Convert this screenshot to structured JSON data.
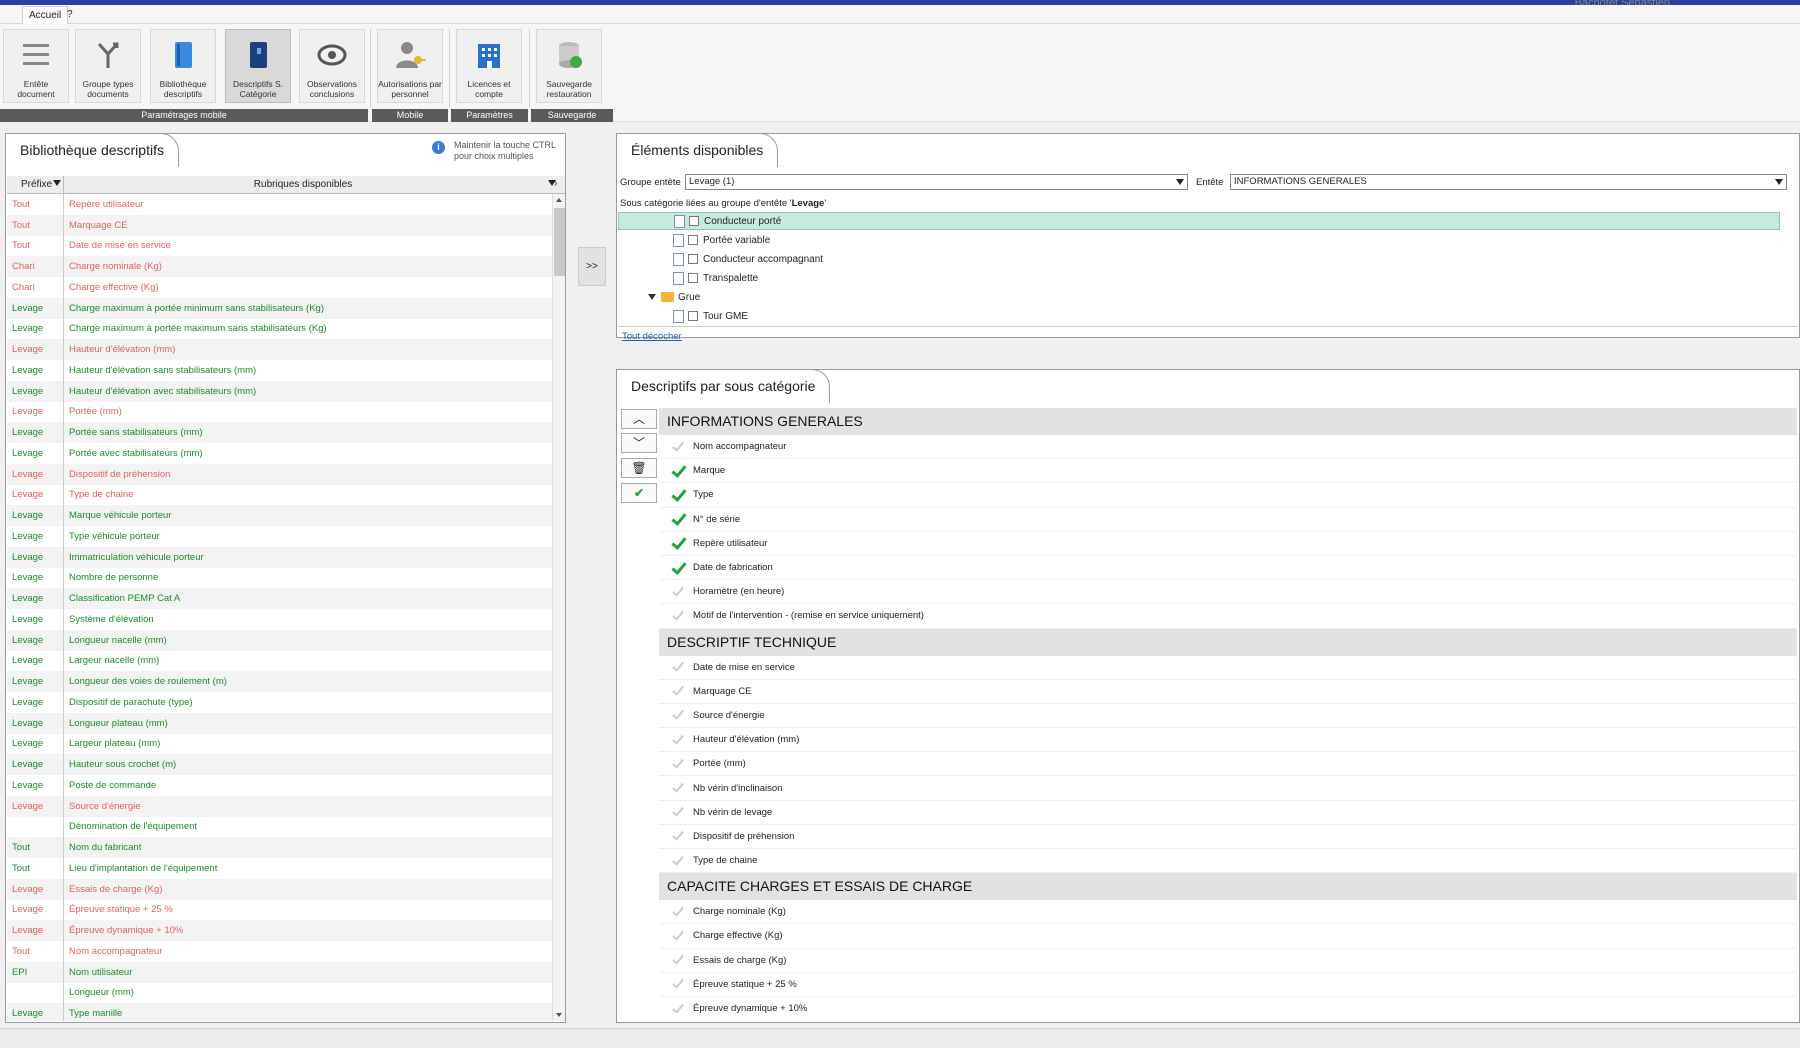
{
  "header": {
    "user": "Bachotet Sébastien"
  },
  "menu": {
    "tabs": [
      "Accueil",
      "?"
    ]
  },
  "ribbon": {
    "buttons": [
      {
        "label": "Entête document",
        "icon": "list-icon"
      },
      {
        "label": "Groupe types documents",
        "icon": "merge-icon"
      },
      {
        "label": "Bibliothèque descriptifs",
        "icon": "book-icon"
      },
      {
        "label": "Descriptifs S. Catégorie",
        "icon": "book-dark-icon"
      },
      {
        "label": "Observations conclusions",
        "icon": "eye-icon"
      },
      {
        "label": "Autorisations par personnel",
        "icon": "user-key-icon"
      },
      {
        "label": "Licences et compte",
        "icon": "building-icon"
      },
      {
        "label": "Sauvegarde restauration",
        "icon": "backup-icon"
      }
    ],
    "groups": [
      "Paramétrages mobile",
      "Mobile",
      "Paramètres",
      "Sauvegarde"
    ]
  },
  "library": {
    "title": "Bibliothèque descriptifs",
    "hint": "Maintenir la touche CTRL pour choix multiples",
    "col_prefix": "Préfixe",
    "col_rubrique": "Rubriques disponibles",
    "rows": [
      {
        "p": "Tout",
        "r": "Repère utilisateur",
        "c": "red"
      },
      {
        "p": "Tout",
        "r": "Marquage CE",
        "c": "red"
      },
      {
        "p": "Tout",
        "r": "Date de mise en service",
        "c": "red"
      },
      {
        "p": "Chari",
        "r": "Charge nominale (Kg)",
        "c": "red"
      },
      {
        "p": "Chari",
        "r": "Charge effective (Kg)",
        "c": "red"
      },
      {
        "p": "Levage",
        "r": "Charge maximum à portée minimum sans stabilisateurs (Kg)",
        "c": "green"
      },
      {
        "p": "Levage",
        "r": "Charge maximum à portée maximum sans stabilisateurs (Kg)",
        "c": "green"
      },
      {
        "p": "Levage",
        "r": "Hauteur d'élévation (mm)",
        "c": "red"
      },
      {
        "p": "Levage",
        "r": "Hauteur d'élévation sans stabilisateurs (mm)",
        "c": "green"
      },
      {
        "p": "Levage",
        "r": "Hauteur d'élévation avec stabilisateurs (mm)",
        "c": "green"
      },
      {
        "p": "Levage",
        "r": "Portée (mm)",
        "c": "red"
      },
      {
        "p": "Levage",
        "r": "Portée sans stabilisateurs (mm)",
        "c": "green"
      },
      {
        "p": "Levage",
        "r": "Portée avec stabilisateurs (mm)",
        "c": "green"
      },
      {
        "p": "Levage",
        "r": "Dispositif de préhension",
        "c": "red"
      },
      {
        "p": "Levage",
        "r": "Type de chaine",
        "c": "red"
      },
      {
        "p": "Levage",
        "r": "Marque véhicule porteur",
        "c": "green"
      },
      {
        "p": "Levage",
        "r": "Type véhicule porteur",
        "c": "green"
      },
      {
        "p": "Levage",
        "r": "Immatriculation véhicule porteur",
        "c": "green"
      },
      {
        "p": "Levage",
        "r": "Nombre de personne",
        "c": "green"
      },
      {
        "p": "Levage",
        "r": "Classification PEMP Cat A",
        "c": "green"
      },
      {
        "p": "Levage",
        "r": "Système d'élévation",
        "c": "green"
      },
      {
        "p": "Levage",
        "r": "Longueur nacelle (mm)",
        "c": "green"
      },
      {
        "p": "Levage",
        "r": "Largeur nacelle (mm)",
        "c": "green"
      },
      {
        "p": "Levage",
        "r": "Longueur des voies de roulement (m)",
        "c": "green"
      },
      {
        "p": "Levage",
        "r": "Dispositif de parachute (type)",
        "c": "green"
      },
      {
        "p": "Levage",
        "r": "Longueur plateau (mm)",
        "c": "green"
      },
      {
        "p": "Levage",
        "r": "Largeur plateau (mm)",
        "c": "green"
      },
      {
        "p": "Levage",
        "r": "Hauteur sous crochet (m)",
        "c": "green"
      },
      {
        "p": "Levage",
        "r": "Poste de commande",
        "c": "green"
      },
      {
        "p": "Levage",
        "r": "Source d'énergie",
        "c": "red"
      },
      {
        "p": "",
        "r": "Dénomination de l'équipement",
        "c": "green"
      },
      {
        "p": "Tout",
        "r": "Nom du fabricant",
        "c": "green"
      },
      {
        "p": "Tout",
        "r": "Lieu d'implantation de l'équipement",
        "c": "green"
      },
      {
        "p": "Levage",
        "r": "Essais de charge (Kg)",
        "c": "red"
      },
      {
        "p": "Levage",
        "r": "Épreuve statique + 25 %",
        "c": "red"
      },
      {
        "p": "Levage",
        "r": "Épreuve dynamique + 10%",
        "c": "red"
      },
      {
        "p": "Tout",
        "r": "Nom accompagnateur",
        "c": "red"
      },
      {
        "p": "EPI",
        "r": "Nom utilisateur",
        "c": "green"
      },
      {
        "p": "",
        "r": "Longueur (mm)",
        "c": "green"
      },
      {
        "p": "Levage",
        "r": "Type manille",
        "c": "green"
      }
    ]
  },
  "move_button": ">>",
  "available": {
    "title": "Éléments disponibles",
    "group_label": "Groupe entête",
    "group_value": "Levage (1)",
    "header_label": "Entête",
    "header_value": "INFORMATIONS GENERALES",
    "subcat_prefix": "Sous catégorie liées au groupe d'entête '",
    "subcat_group": "Levage",
    "subcat_suffix": "'",
    "tree": [
      {
        "label": "Conducteur porté",
        "type": "doc",
        "highlight": true
      },
      {
        "label": "Portée variable",
        "type": "doc"
      },
      {
        "label": "Conducteur accompagnant",
        "type": "doc"
      },
      {
        "label": "Transpalette",
        "type": "doc"
      },
      {
        "label": "Grue",
        "type": "folder"
      },
      {
        "label": "Tour GME",
        "type": "doc"
      }
    ],
    "uncheck_all": "Tout décocher"
  },
  "descriptifs": {
    "title": "Descriptifs par sous catégorie",
    "sections": [
      {
        "title": "INFORMATIONS GENERALES",
        "items": [
          {
            "label": "Nom accompagnateur",
            "checked": false
          },
          {
            "label": "Marque",
            "checked": true
          },
          {
            "label": "Type",
            "checked": true
          },
          {
            "label": "N° de série",
            "checked": true
          },
          {
            "label": "Repère utilisateur",
            "checked": true
          },
          {
            "label": "Date de fabrication",
            "checked": true
          },
          {
            "label": "Horamètre (en heure)",
            "checked": false
          },
          {
            "label": "Motif de l'intervention - (remise en service uniquement)",
            "checked": false
          }
        ]
      },
      {
        "title": "DESCRIPTIF TECHNIQUE",
        "items": [
          {
            "label": "Date de mise en service",
            "checked": false
          },
          {
            "label": "Marquage CE",
            "checked": false
          },
          {
            "label": "Source d'énergie",
            "checked": false
          },
          {
            "label": "Hauteur d'élévation (mm)",
            "checked": false
          },
          {
            "label": "Portée (mm)",
            "checked": false
          },
          {
            "label": "Nb vérin d'inclinaison",
            "checked": false
          },
          {
            "label": "Nb vérin de levage",
            "checked": false
          },
          {
            "label": "Dispositif de préhension",
            "checked": false
          },
          {
            "label": "Type de chaine",
            "checked": false
          }
        ]
      },
      {
        "title": "CAPACITE CHARGES ET ESSAIS DE CHARGE",
        "items": [
          {
            "label": "Charge nominale (Kg)",
            "checked": false
          },
          {
            "label": "Charge effective (Kg)",
            "checked": false
          },
          {
            "label": "Essais de charge (Kg)",
            "checked": false
          },
          {
            "label": "Épreuve statique + 25 %",
            "checked": false
          },
          {
            "label": "Épreuve dynamique + 10%",
            "checked": false
          }
        ]
      }
    ]
  },
  "colors": {
    "accent": "#2a3f9f",
    "red_text": "#e0625e",
    "green_text": "#1f8a2c",
    "highlight": "#c8eadc",
    "check": "#21a33d"
  }
}
